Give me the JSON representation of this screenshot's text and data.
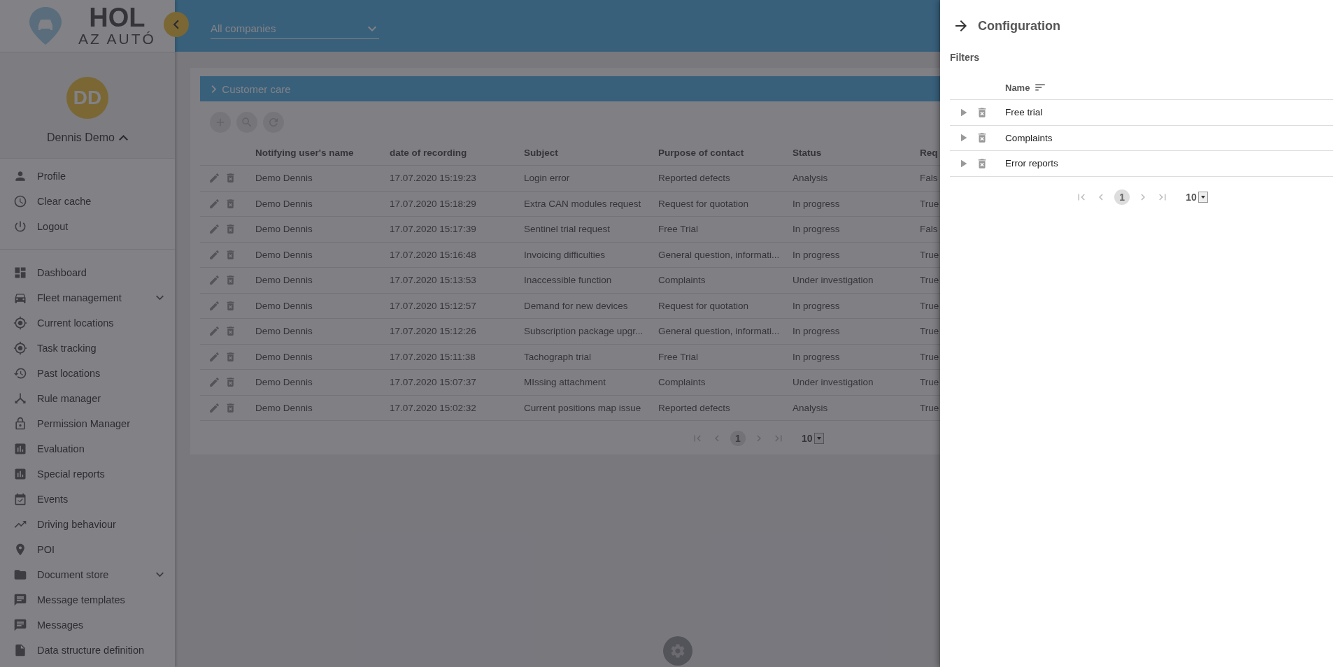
{
  "logo": {
    "line1": "HOL",
    "line2": "AZ AUTÓ"
  },
  "topbar": {
    "company_select": {
      "value": "All companies"
    }
  },
  "user": {
    "initials": "DD",
    "name": "Dennis Demo",
    "expanded": true
  },
  "user_menu": [
    {
      "label": "Profile"
    },
    {
      "label": "Clear cache"
    },
    {
      "label": "Logout"
    }
  ],
  "nav": [
    {
      "label": "Dashboard",
      "kind": "link"
    },
    {
      "label": "Fleet management",
      "kind": "group",
      "expanded": false
    },
    {
      "label": "Current locations",
      "kind": "link"
    },
    {
      "label": "Task tracking",
      "kind": "link"
    },
    {
      "label": "Past locations",
      "kind": "link"
    },
    {
      "label": "Rule manager",
      "kind": "link"
    },
    {
      "label": "Permission Manager",
      "kind": "link"
    },
    {
      "label": "Evaluation",
      "kind": "link"
    },
    {
      "label": "Special reports",
      "kind": "link"
    },
    {
      "label": "Events",
      "kind": "link"
    },
    {
      "label": "Driving behaviour",
      "kind": "link"
    },
    {
      "label": "POI",
      "kind": "link"
    },
    {
      "label": "Document store",
      "kind": "group",
      "expanded": false
    },
    {
      "label": "Message templates",
      "kind": "link"
    },
    {
      "label": "Messages",
      "kind": "link"
    },
    {
      "label": "Data structure definition",
      "kind": "link"
    }
  ],
  "section": {
    "title": "Customer care",
    "expanded": false
  },
  "table": {
    "columns": [
      "Notifying user's name",
      "date of recording",
      "Subject",
      "Purpose of contact",
      "Status",
      "Req"
    ],
    "rows": [
      {
        "cells": [
          "Demo Dennis",
          "17.07.2020 15:19:23",
          "Login error",
          "Reported defects",
          "Analysis",
          "Fals"
        ]
      },
      {
        "cells": [
          "Demo Dennis",
          "17.07.2020 15:18:29",
          "Extra CAN modules request",
          "Request for quotation",
          "In progress",
          "True"
        ]
      },
      {
        "cells": [
          "Demo Dennis",
          "17.07.2020 15:17:39",
          "Sentinel trial request",
          "Free Trial",
          "In progress",
          "Fals"
        ]
      },
      {
        "cells": [
          "Demo Dennis",
          "17.07.2020 15:16:48",
          "Invoicing difficulties",
          "General question, informati...",
          "In progress",
          "True"
        ]
      },
      {
        "cells": [
          "Demo Dennis",
          "17.07.2020 15:13:53",
          "Inaccessible function",
          "Complaints",
          "Under investigation",
          "True"
        ]
      },
      {
        "cells": [
          "Demo Dennis",
          "17.07.2020 15:12:57",
          "Demand for new devices",
          "Request for quotation",
          "In progress",
          "True"
        ]
      },
      {
        "cells": [
          "Demo Dennis",
          "17.07.2020 15:12:26",
          "Subscription package upgr...",
          "General question, informati...",
          "In progress",
          "True"
        ]
      },
      {
        "cells": [
          "Demo Dennis",
          "17.07.2020 15:11:38",
          "Tachograph trial",
          "Free Trial",
          "In progress",
          "True"
        ]
      },
      {
        "cells": [
          "Demo Dennis",
          "17.07.2020 15:07:37",
          "MIssing attachment",
          "Complaints",
          "Under investigation",
          "True"
        ]
      },
      {
        "cells": [
          "Demo Dennis",
          "17.07.2020 15:02:32",
          "Current positions map issue",
          "Reported defects",
          "Analysis",
          "True"
        ]
      }
    ]
  },
  "pagination": {
    "pages": [
      {
        "label": "1",
        "selected": true
      }
    ],
    "page_size": "10"
  },
  "config_panel": {
    "title": "Configuration",
    "section": "Filters",
    "columns": [
      "Name"
    ],
    "rows": [
      {
        "name": "Free trial",
        "expanded": false
      },
      {
        "name": "Complaints",
        "expanded": false
      },
      {
        "name": "Error reports",
        "expanded": false
      }
    ],
    "pagination": {
      "pages": [
        {
          "label": "1",
          "selected": true
        }
      ],
      "page_size": "10"
    }
  }
}
